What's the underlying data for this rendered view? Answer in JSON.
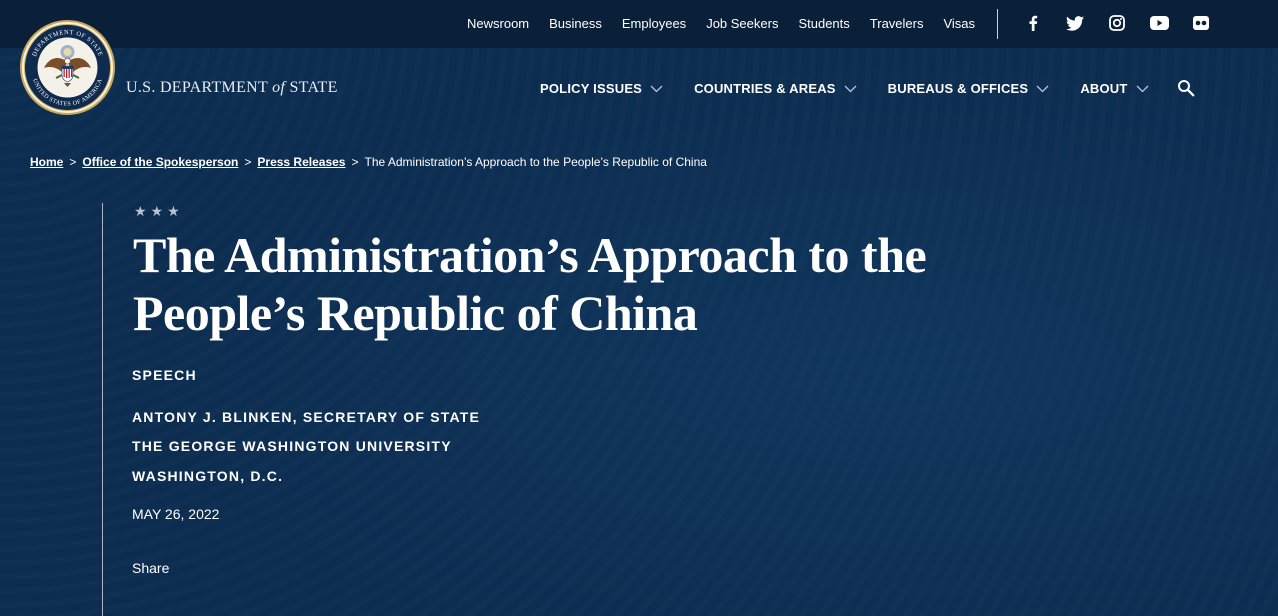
{
  "utility": {
    "links": [
      "Newsroom",
      "Business",
      "Employees",
      "Job Seekers",
      "Students",
      "Travelers",
      "Visas"
    ],
    "social_icons": [
      "facebook-icon",
      "twitter-icon",
      "instagram-icon",
      "youtube-icon",
      "flickr-icon"
    ]
  },
  "brand": {
    "seal_top_text": "DEPARTMENT OF STATE",
    "seal_bottom_text": "UNITED STATES OF AMERICA",
    "name_prefix": "U.S. DEPARTMENT",
    "name_of": "of",
    "name_suffix": "STATE"
  },
  "nav": {
    "items": [
      "POLICY ISSUES",
      "COUNTRIES & AREAS",
      "BUREAUS & OFFICES",
      "ABOUT"
    ],
    "search_icon": "search-icon"
  },
  "breadcrumb": {
    "home": "Home",
    "spokesperson": "Office of the Spokesperson",
    "press": "Press Releases",
    "separator": ">",
    "current": "The Administration’s Approach to the People’s Republic of China"
  },
  "article": {
    "stars": "★★★",
    "title": "The Administration’s Approach to the People’s Republic of China",
    "type": "SPEECH",
    "speaker": "ANTONY J. BLINKEN, SECRETARY OF STATE",
    "venue": "THE GEORGE WASHINGTON UNIVERSITY",
    "location": "WASHINGTON, D.C.",
    "date": "MAY 26, 2022",
    "share": "Share"
  },
  "colors": {
    "background": "#0c2d50",
    "utility_bar": "#0a2038",
    "seal_gold": "#c9a85a"
  }
}
